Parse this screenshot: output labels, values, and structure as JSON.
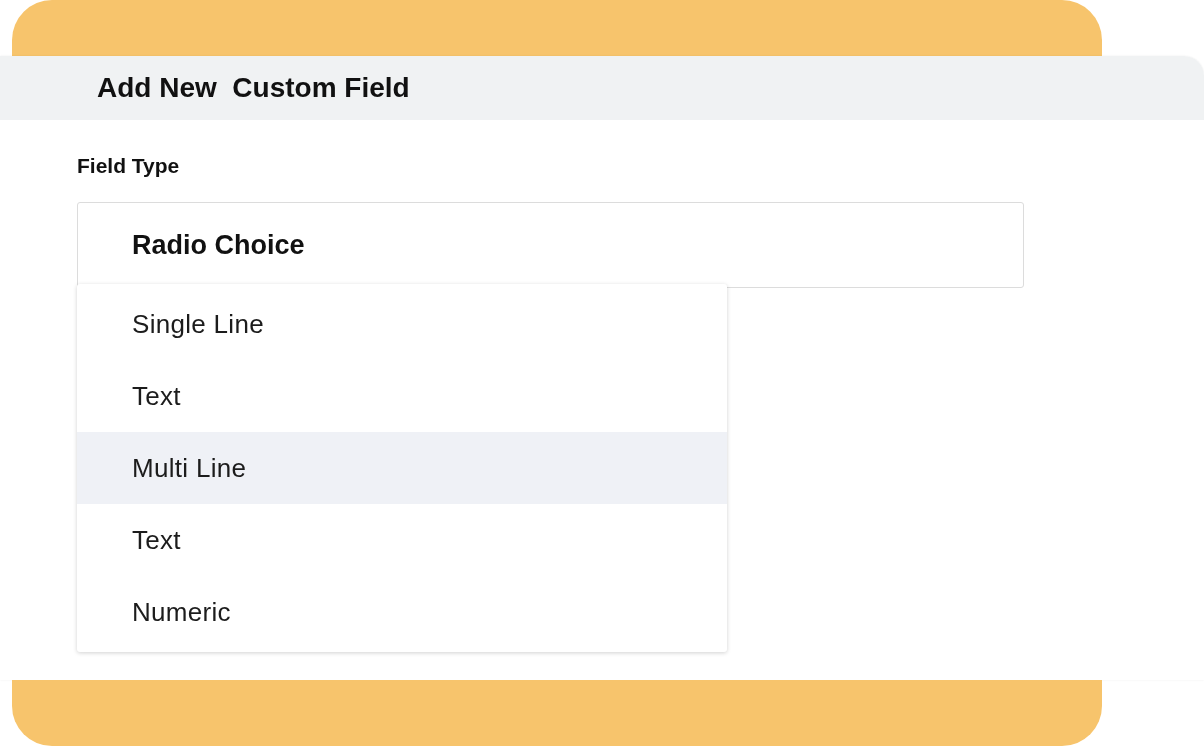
{
  "dialog": {
    "title": "Add New  Custom Field"
  },
  "field_type": {
    "label": "Field Type",
    "value": "Radio Choice",
    "expanded": true
  },
  "options": [
    {
      "label": "Single Line",
      "selected": false
    },
    {
      "label": "Text",
      "selected": false
    },
    {
      "label": "Multi Line",
      "selected": true
    },
    {
      "label": "Text",
      "selected": false
    },
    {
      "label": "Numeric",
      "selected": false
    }
  ]
}
